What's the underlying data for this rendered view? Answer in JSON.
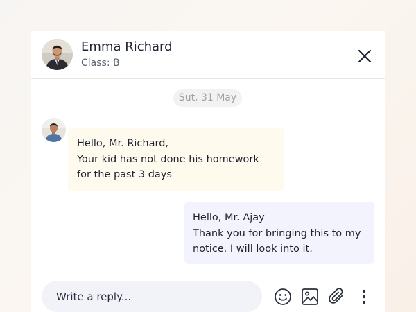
{
  "header": {
    "contact_name": "Emma Richard",
    "contact_class": "Class: B"
  },
  "chat": {
    "date_divider": "Sut, 31 May",
    "messages": [
      {
        "direction": "incoming",
        "lines": [
          "Hello, Mr. Richard,",
          "Your kid has not done his homework",
          "for the past 3 days"
        ]
      },
      {
        "direction": "outgoing",
        "lines": [
          "Hello, Mr. Ajay",
          "Thank you for bringing this to my",
          "notice. I will look into it."
        ]
      }
    ]
  },
  "composer": {
    "placeholder": "Write a reply..."
  },
  "icons": {
    "close": "close-icon",
    "emoji": "smiley-icon",
    "image": "image-icon",
    "attach": "paperclip-icon",
    "more": "more-vertical-icon"
  },
  "colors": {
    "incoming_bubble": "#fffaee",
    "outgoing_bubble": "#f3f3fe",
    "date_pill": "#f2f2f2",
    "composer_bg": "#f1f3f9",
    "text_primary": "#1d2433"
  }
}
